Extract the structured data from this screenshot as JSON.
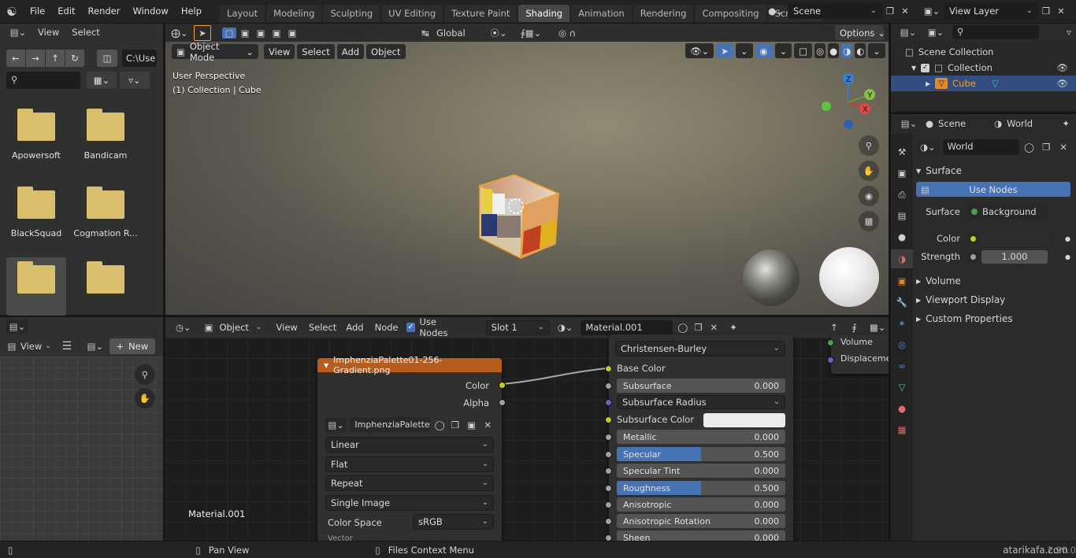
{
  "topbar": {
    "menus": [
      "File",
      "Edit",
      "Render",
      "Window",
      "Help"
    ],
    "tabs": [
      "Layout",
      "Modeling",
      "Sculpting",
      "UV Editing",
      "Texture Paint",
      "Shading",
      "Animation",
      "Rendering",
      "Compositing",
      "Scripting"
    ],
    "active_tab": "Shading",
    "add_tab": "+",
    "scene": "Scene",
    "view_layer": "View Layer"
  },
  "filebrowser": {
    "menus": [
      "View",
      "Select"
    ],
    "path": "C:\\Use",
    "folders": [
      "Apowersoft",
      "Bandicam",
      "BlackSquad",
      "Cogmation R...",
      "",
      ""
    ]
  },
  "viewport": {
    "mode": "Object Mode",
    "menus": [
      "View",
      "Select",
      "Add",
      "Object"
    ],
    "orientation": "Global",
    "options": "Options",
    "info_line1": "User Perspective",
    "info_line2": "(1) Collection | Cube",
    "gizmo": {
      "z": "Z",
      "y": "Y",
      "x": "X"
    }
  },
  "imageeditor": {
    "view": "View",
    "new_label": "New"
  },
  "nodeeditor": {
    "object": "Object",
    "menus": [
      "View",
      "Select",
      "Add",
      "Node"
    ],
    "use_nodes": "Use Nodes",
    "slot": "Slot 1",
    "material": "Material.001",
    "footer_material": "Material.001",
    "image_node": {
      "title": "ImphenziaPalette01-256-Gradient.png",
      "out_color": "Color",
      "out_alpha": "Alpha",
      "image_name": "ImphenziaPalette...",
      "interpolation": "Linear",
      "projection": "Flat",
      "extension": "Repeat",
      "source": "Single Image",
      "color_space_label": "Color Space",
      "color_space": "sRGB",
      "cut_text": "Vector"
    },
    "bsdf_node": {
      "subsurface_method": "Christensen-Burley",
      "base_color": "Base Color",
      "subsurface": {
        "label": "Subsurface",
        "value": "0.000"
      },
      "subsurface_radius": "Subsurface Radius",
      "subsurface_color": "Subsurface Color",
      "metallic": {
        "label": "Metallic",
        "value": "0.000",
        "fill": 0
      },
      "specular": {
        "label": "Specular",
        "value": "0.500",
        "fill": 0.5
      },
      "specular_tint": {
        "label": "Specular Tint",
        "value": "0.000",
        "fill": 0
      },
      "roughness": {
        "label": "Roughness",
        "value": "0.500",
        "fill": 0.5
      },
      "anisotropic": {
        "label": "Anisotropic",
        "value": "0.000",
        "fill": 0
      },
      "anisotropic_rotation": {
        "label": "Anisotropic Rotation",
        "value": "0.000",
        "fill": 0
      },
      "sheen": {
        "label": "Sheen",
        "value": "0.000",
        "fill": 0
      }
    },
    "output_node": {
      "volume": "Volume",
      "displacement": "Displaceme"
    }
  },
  "outliner": {
    "title": "Scene Collection",
    "collection": "Collection",
    "cube": "Cube"
  },
  "properties": {
    "scene": "Scene",
    "world_tab": "World",
    "world_name": "World",
    "surface_panel": "Surface",
    "use_nodes": "Use Nodes",
    "surface_label": "Surface",
    "surface_value": "Background",
    "color_label": "Color",
    "strength_label": "Strength",
    "strength_value": "1.000",
    "panels": [
      "Volume",
      "Viewport Display",
      "Custom Properties"
    ]
  },
  "status": {
    "pan": "Pan View",
    "context": "Files Context Menu",
    "version": "2.90.0",
    "watermark": "atarikafa.com"
  },
  "colors": {
    "accent": "#4772b3",
    "active_tab": "#474747",
    "header_node": "#b85c1c",
    "sel_orange": "#f0a030",
    "annot_blue": "#1a1aff"
  }
}
